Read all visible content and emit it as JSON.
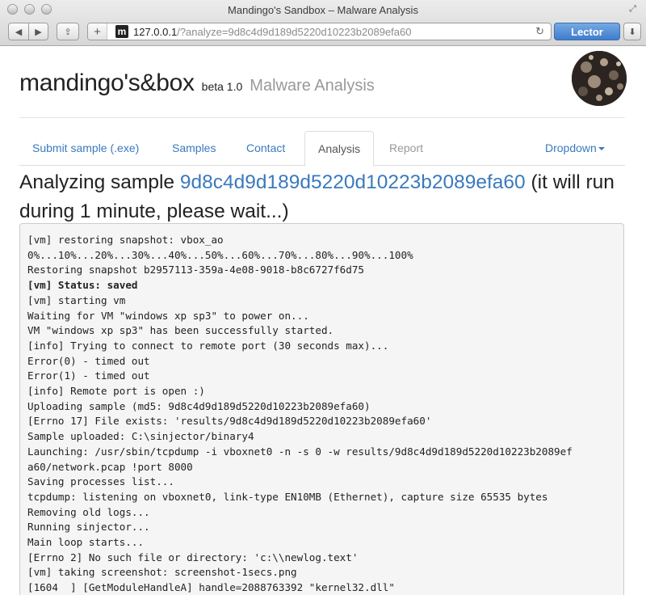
{
  "window": {
    "title": "Mandingo's Sandbox – Malware Analysis"
  },
  "toolbar": {
    "back_icon": "◀",
    "forward_icon": "▶",
    "share_icon": "⇪",
    "plus_icon": "+",
    "favicon_letter": "m",
    "url_host": "127.0.0.1",
    "url_rest": "/?analyze=9d8c4d9d189d5220d10223b2089efa60",
    "reload_icon": "↻",
    "reader_label": "Lector",
    "download_icon": "⬇"
  },
  "header": {
    "brand": "mandingo's&box",
    "version": "beta 1.0",
    "subtitle": "Malware Analysis"
  },
  "nav": {
    "tabs": [
      {
        "label": "Submit sample (.exe)"
      },
      {
        "label": "Samples"
      },
      {
        "label": "Contact"
      },
      {
        "label": "Analysis"
      },
      {
        "label": "Report"
      }
    ],
    "dropdown_label": "Dropdown"
  },
  "heading": {
    "prefix": "Analyzing sample ",
    "sample_hash": "9d8c4d9d189d5220d10223b2089efa60",
    "suffix": " (it will run during 1 minute, please wait...)"
  },
  "console": {
    "lines": [
      "[vm] restoring snapshot: vbox_ao",
      "0%...10%...20%...30%...40%...50%...60%...70%...80%...90%...100%",
      "Restoring snapshot b2957113-359a-4e08-9018-b8c6727f6d75",
      "[vm] Status: saved",
      "[vm] starting vm",
      "Waiting for VM \"windows xp sp3\" to power on...",
      "VM \"windows xp sp3\" has been successfully started.",
      "[info] Trying to connect to remote port (30 seconds max)...",
      "Error(0) - timed out",
      "Error(1) - timed out",
      "[info] Remote port is open :)",
      "Uploading sample (md5: 9d8c4d9d189d5220d10223b2089efa60)",
      "[Errno 17] File exists: 'results/9d8c4d9d189d5220d10223b2089efa60'",
      "Sample uploaded: C:\\sinjector/binary4",
      "Launching: /usr/sbin/tcpdump -i vboxnet0 -n -s 0 -w results/9d8c4d9d189d5220d10223b2089ef",
      "a60/network.pcap !port 8000",
      "Saving processes list...",
      "tcpdump: listening on vboxnet0, link-type EN10MB (Ethernet), capture size 65535 bytes",
      "Removing old logs...",
      "Running sinjector...",
      "Main loop starts...",
      "[Errno 2] No such file or directory: 'c:\\\\newlog.text'",
      "[vm] taking screenshot: screenshot-1secs.png",
      "[1604  ] [GetModuleHandleA] handle=2088763392 \"kernel32.dll\""
    ]
  },
  "colors": {
    "link": "#3a7abd",
    "muted": "#999999",
    "console_bg": "#f5f5f5"
  }
}
